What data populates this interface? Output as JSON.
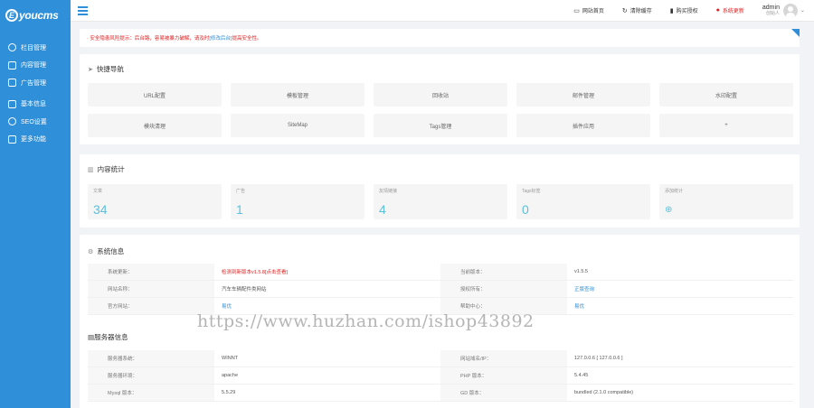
{
  "sidebar": {
    "logo_letter": "E",
    "logo_text": "youcms",
    "items": [
      {
        "label": "栏目管理",
        "icon": "gear-icon"
      },
      {
        "label": "内容管理",
        "icon": "document-icon"
      },
      {
        "label": "广告管理",
        "icon": "image-icon"
      },
      {
        "label": "基本信息",
        "icon": "briefcase-icon"
      },
      {
        "label": "SEO设置",
        "icon": "globe-icon"
      },
      {
        "label": "更多功能",
        "icon": "grid-icon"
      }
    ]
  },
  "topbar": {
    "links": [
      {
        "label": "网站首页",
        "icon": "monitor-icon"
      },
      {
        "label": "清除缓存",
        "icon": "refresh-icon"
      },
      {
        "label": "购买授权",
        "icon": "bookmark-icon"
      },
      {
        "label": "系统更新",
        "icon": "alert-icon"
      }
    ],
    "admin_name": "admin",
    "admin_role": "创始人"
  },
  "notice": {
    "prefix": "· 安全隐患风险提示：后台路，容易被暴力破解，请及时",
    "link": "[修改后台]",
    "suffix": "提高安全性。"
  },
  "quick_nav": {
    "title": "快捷导航",
    "items": [
      "URL配置",
      "模板管理",
      "回收站",
      "邮件管理",
      "水印配置",
      "模块清理",
      "SiteMap",
      "Tags管理",
      "插件应用",
      "+"
    ]
  },
  "content_stats": {
    "title": "内容统计",
    "items": [
      {
        "label": "文章",
        "value": "34"
      },
      {
        "label": "广告",
        "value": "1"
      },
      {
        "label": "友情链接",
        "value": "4"
      },
      {
        "label": "Tags标签",
        "value": "0"
      },
      {
        "label": "添加统计",
        "value": "⊕"
      }
    ]
  },
  "system_info": {
    "title": "系统信息",
    "rows": [
      {
        "k1": "系统更新：",
        "v1": "检测到新版本v1.5.8[点击查看]",
        "k2": "当前版本：",
        "v2": "v1.5.5"
      },
      {
        "k1": "网站名称：",
        "v1": "汽车车辆配件类网站",
        "k2": "授权所有：",
        "v2": "正版查询"
      },
      {
        "k1": "官方网站：",
        "v1": "易优",
        "k2": "帮助中心：",
        "v2": "易优"
      }
    ]
  },
  "server_info": {
    "title": "服务器信息",
    "rows": [
      {
        "k1": "服务器系统：",
        "v1": "WINNT",
        "k2": "网站域名/IP：",
        "v2": "127.0.0.6 [ 127.0.0.6 ]"
      },
      {
        "k1": "服务器环境：",
        "v1": "apache",
        "k2": "PHP 版本：",
        "v2": "5.4.45"
      },
      {
        "k1": "Mysql 版本：",
        "v1": "5.5.29",
        "k2": "GD 版本：",
        "v2": "bundled (2.1.0 compatible)"
      }
    ]
  },
  "watermark": "https://www.huzhan.com/ishop43892",
  "colors": {
    "accent": "#2f8fd8",
    "stat_value": "#5bc0de",
    "alert": "#e02020"
  }
}
